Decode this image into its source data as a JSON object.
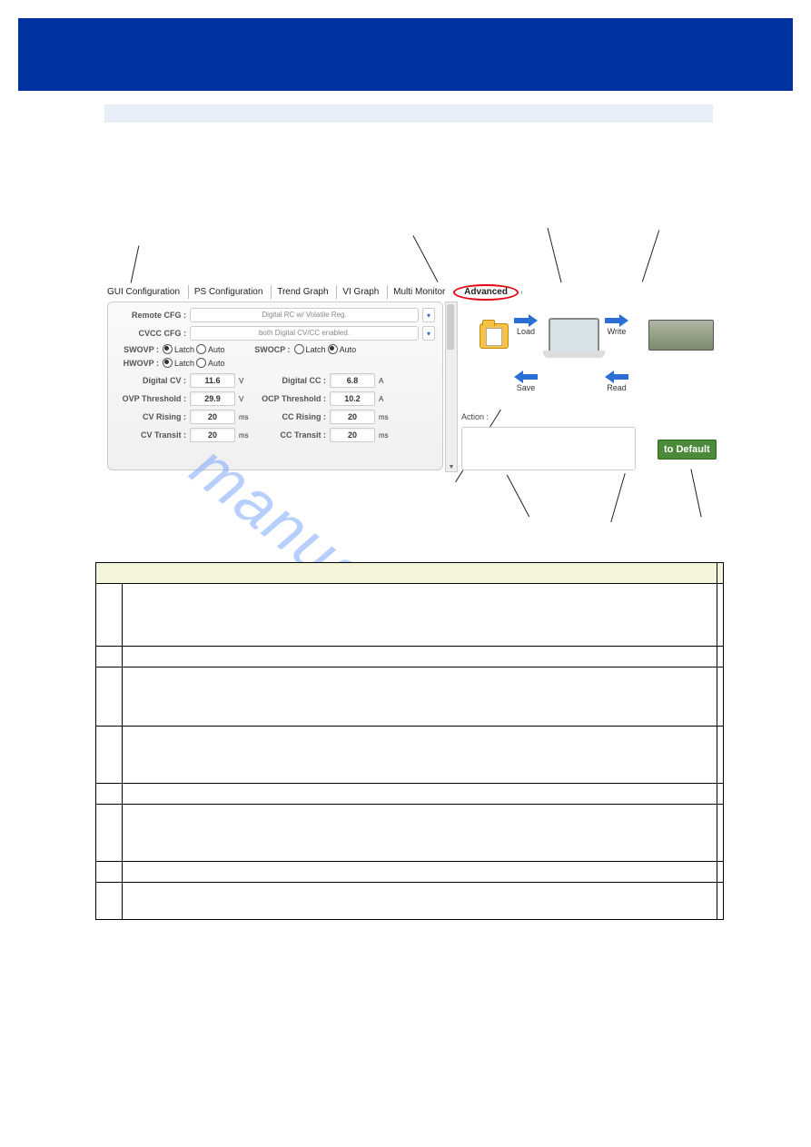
{
  "tabs": [
    "GUI Configuration",
    "PS Configuration",
    "Trend Graph",
    "VI Graph",
    "Multi Monitor",
    "Advanced"
  ],
  "panel": {
    "remote_cfg_label": "Remote CFG :",
    "remote_cfg_value": "Digital RC w/ Volatile Reg.",
    "cvcc_cfg_label": "CVCC CFG :",
    "cvcc_cfg_value": "both Digital CV/CC enabled.",
    "swovp_label": "SWOVP :",
    "swocp_label": "SWOCP :",
    "hwovp_label": "HWOVP :",
    "latch": "Latch",
    "auto": "Auto",
    "fields": {
      "digital_cv": {
        "label": "Digital CV :",
        "value": "11.6",
        "unit": "V"
      },
      "digital_cc": {
        "label": "Digital CC :",
        "value": "6.8",
        "unit": "A"
      },
      "ovp_thr": {
        "label": "OVP Threshold :",
        "value": "29.9",
        "unit": "V"
      },
      "ocp_thr": {
        "label": "OCP Threshold :",
        "value": "10.2",
        "unit": "A"
      },
      "cv_rising": {
        "label": "CV Rising :",
        "value": "20",
        "unit": "ms"
      },
      "cc_rising": {
        "label": "CC Rising :",
        "value": "20",
        "unit": "ms"
      },
      "cv_transit": {
        "label": "CV Transit :",
        "value": "20",
        "unit": "ms"
      },
      "cc_transit": {
        "label": "CC Transit :",
        "value": "20",
        "unit": "ms"
      }
    }
  },
  "right": {
    "load": "Load",
    "write": "Write",
    "save": "Save",
    "read": "Read",
    "action": "Action :",
    "to_default": "to Default"
  },
  "watermark": "manualshive.com"
}
